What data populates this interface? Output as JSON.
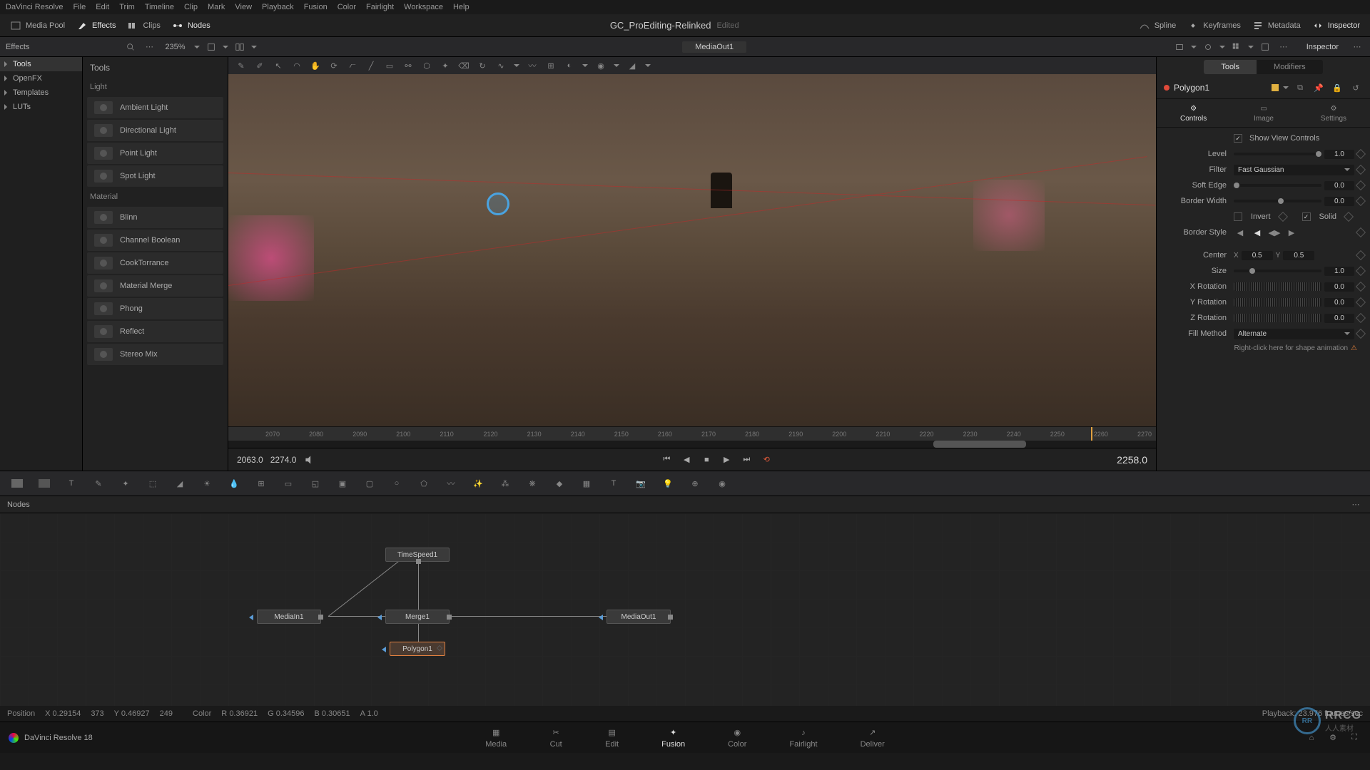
{
  "menubar": [
    "DaVinci Resolve",
    "File",
    "Edit",
    "Trim",
    "Timeline",
    "Clip",
    "Mark",
    "View",
    "Playback",
    "Fusion",
    "Color",
    "Fairlight",
    "Workspace",
    "Help"
  ],
  "toolbar": {
    "media_pool": "Media Pool",
    "effects": "Effects",
    "clips": "Clips",
    "nodes": "Nodes",
    "spline": "Spline",
    "keyframes": "Keyframes",
    "metadata": "Metadata",
    "inspector": "Inspector"
  },
  "project": {
    "title": "GC_ProEditing-Relinked",
    "status": "Edited"
  },
  "secondary": {
    "effects_label": "Effects",
    "zoom": "235%",
    "viewer_label": "MediaOut1",
    "inspector_label": "Inspector"
  },
  "sidebar_tree": [
    "Tools",
    "OpenFX",
    "Templates",
    "LUTs"
  ],
  "tools_panel": {
    "header": "Tools",
    "sections": [
      {
        "label": "Light",
        "items": [
          "Ambient Light",
          "Directional Light",
          "Point Light",
          "Spot Light"
        ]
      },
      {
        "label": "Material",
        "items": [
          "Blinn",
          "Channel Boolean",
          "CookTorrance",
          "Material Merge",
          "Phong",
          "Reflect",
          "Stereo Mix"
        ]
      }
    ]
  },
  "playback": {
    "in": "2063.0",
    "out": "2274.0",
    "current": "2258.0"
  },
  "timeline_ticks": [
    "2070",
    "2080",
    "2090",
    "2100",
    "2110",
    "2120",
    "2130",
    "2140",
    "2150",
    "2160",
    "2170",
    "2180",
    "2190",
    "2200",
    "2210",
    "2220",
    "2230",
    "2240",
    "2250",
    "2260",
    "2270"
  ],
  "inspector": {
    "tabs": [
      "Tools",
      "Modifiers"
    ],
    "node_name": "Polygon1",
    "subtabs": [
      "Controls",
      "Image",
      "Settings"
    ],
    "show_view_controls": "Show View Controls",
    "props": {
      "level_label": "Level",
      "level_value": "1.0",
      "filter_label": "Filter",
      "filter_value": "Fast Gaussian",
      "softedge_label": "Soft Edge",
      "softedge_value": "0.0",
      "borderwidth_label": "Border Width",
      "borderwidth_value": "0.0",
      "invert_label": "Invert",
      "solid_label": "Solid",
      "borderstyle_label": "Border Style",
      "center_label": "Center",
      "center_x": "0.5",
      "center_y": "0.5",
      "size_label": "Size",
      "size_value": "1.0",
      "xrot_label": "X Rotation",
      "xrot_value": "0.0",
      "yrot_label": "Y Rotation",
      "yrot_value": "0.0",
      "zrot_label": "Z Rotation",
      "zrot_value": "0.0",
      "fillmethod_label": "Fill Method",
      "fillmethod_value": "Alternate",
      "hint": "Right-click here for shape animation"
    }
  },
  "nodes_panel": {
    "label": "Nodes"
  },
  "nodes": {
    "mediain": "MediaIn1",
    "timespeed": "TimeSpeed1",
    "merge": "Merge1",
    "polygon": "Polygon1",
    "mediaout": "MediaOut1"
  },
  "status": {
    "pos_label": "Position",
    "x_label": "X",
    "x_val": "0.29154",
    "x_px": "373",
    "y_label": "Y",
    "y_val": "0.46927",
    "y_px": "249",
    "color_label": "Color",
    "r_label": "R",
    "r_val": "0.36921",
    "g_label": "G",
    "g_val": "0.34596",
    "b_label": "B",
    "b_val": "0.30651",
    "a_label": "A",
    "a_val": "1.0",
    "playback": "Playback: 23.976 frames/sec"
  },
  "pages": {
    "app": "DaVinci Resolve 18",
    "items": [
      "Media",
      "Cut",
      "Edit",
      "Fusion",
      "Color",
      "Fairlight",
      "Deliver"
    ]
  },
  "corner_logo": {
    "ring": "RR",
    "text": "RRCG",
    "sub": "人人素材"
  }
}
